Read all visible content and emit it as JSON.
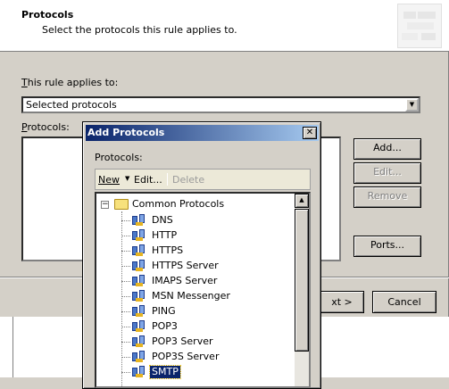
{
  "wizard": {
    "title": "Protocols",
    "subtitle": "Select the protocols this rule applies to.",
    "applies_label_prefix": "T",
    "applies_label_rest": "his rule applies to:",
    "applies_value": "Selected protocols",
    "protocols_label_prefix": "P",
    "protocols_label_rest": "rotocols:",
    "buttons": {
      "add": "Add...",
      "edit": "Edit...",
      "remove": "Remove",
      "ports": "Ports...",
      "next": "xt >",
      "cancel": "Cancel"
    }
  },
  "dialog": {
    "title": "Add Protocols",
    "close_glyph": "✕",
    "protocols_label": "Protocols:",
    "toolbar": {
      "new": "New",
      "edit": "Edit...",
      "delete": "Delete"
    },
    "tree": {
      "root": "Common Protocols",
      "items": [
        {
          "label": "DNS"
        },
        {
          "label": "HTTP"
        },
        {
          "label": "HTTPS"
        },
        {
          "label": "HTTPS Server"
        },
        {
          "label": "IMAPS Server"
        },
        {
          "label": "MSN Messenger"
        },
        {
          "label": "PING"
        },
        {
          "label": "POP3"
        },
        {
          "label": "POP3 Server"
        },
        {
          "label": "POP3S Server"
        },
        {
          "label": "SMTP",
          "selected": true
        }
      ]
    }
  }
}
